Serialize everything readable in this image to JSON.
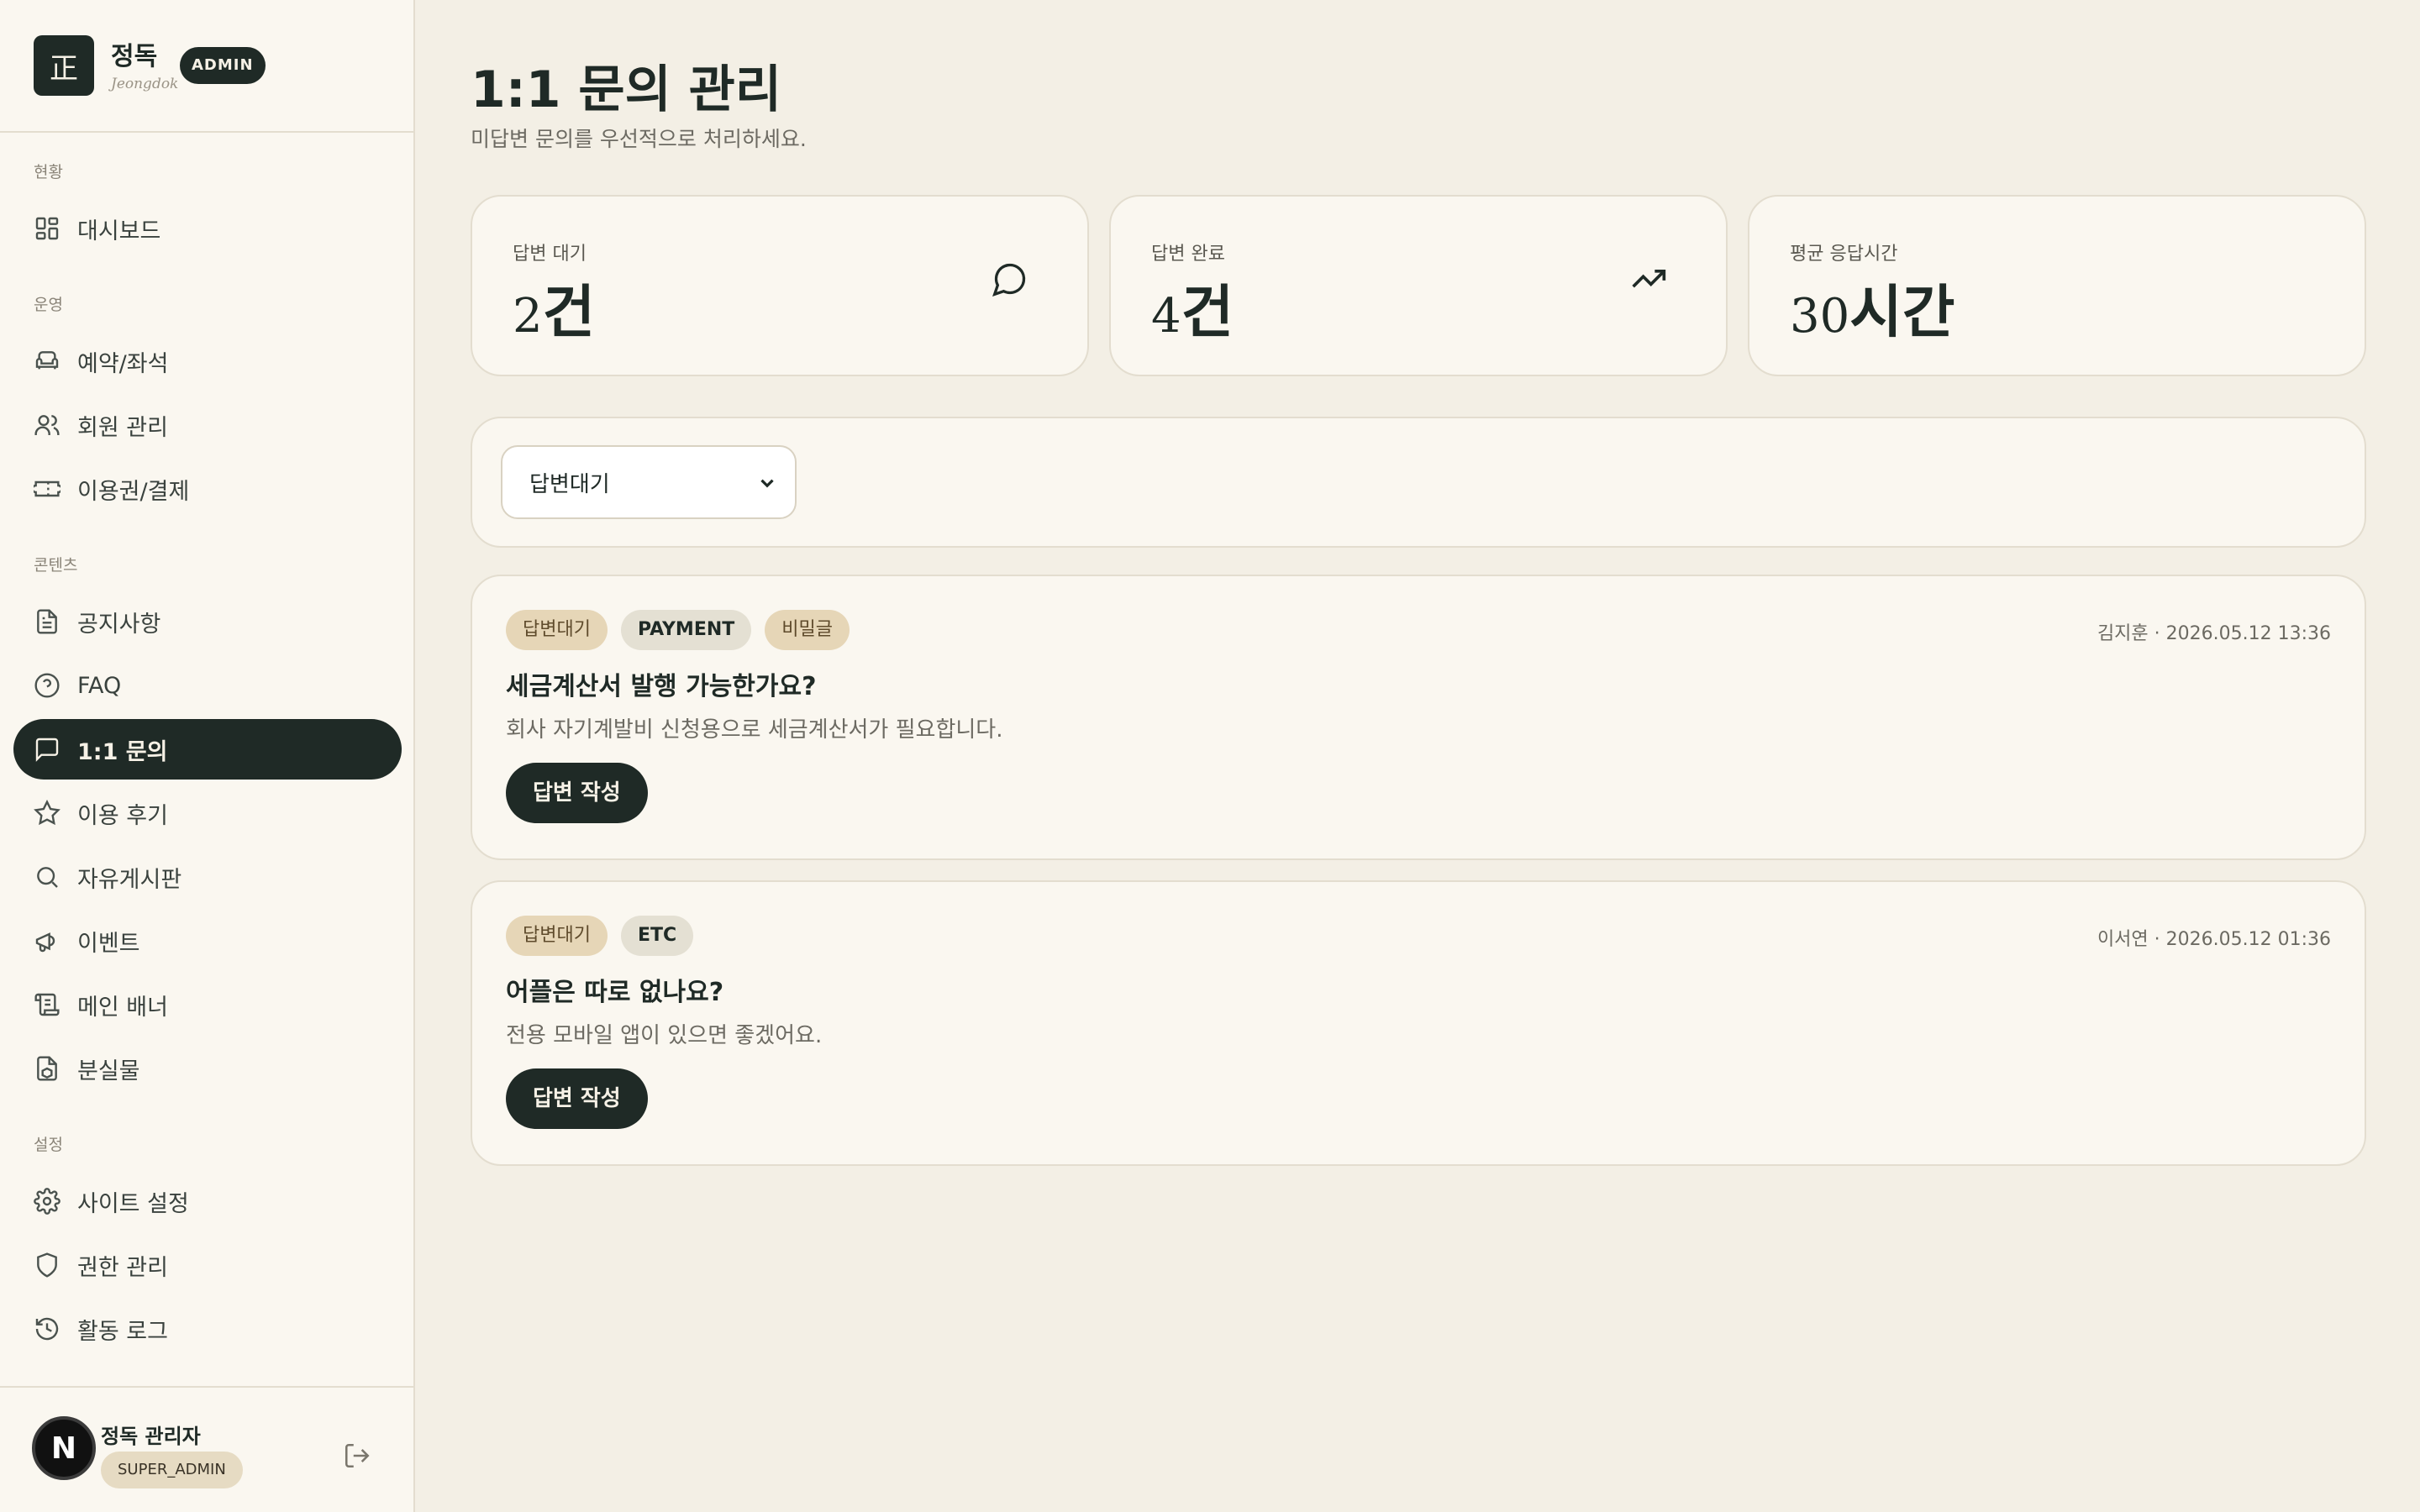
{
  "brand": {
    "logo_char": "正",
    "name": "정독",
    "subtitle": "Jeongdok",
    "badge": "ADMIN"
  },
  "sidebar": {
    "sections": [
      {
        "label": "현황",
        "items": [
          {
            "label": "대시보드",
            "icon": "dashboard-icon"
          }
        ]
      },
      {
        "label": "운영",
        "items": [
          {
            "label": "예약/좌석",
            "icon": "armchair-icon"
          },
          {
            "label": "회원 관리",
            "icon": "users-icon"
          },
          {
            "label": "이용권/결제",
            "icon": "ticket-icon"
          }
        ]
      },
      {
        "label": "콘텐츠",
        "items": [
          {
            "label": "공지사항",
            "icon": "document-icon"
          },
          {
            "label": "FAQ",
            "icon": "help-circle-icon"
          },
          {
            "label": "1:1 문의",
            "icon": "message-square-icon",
            "active": true
          },
          {
            "label": "이용 후기",
            "icon": "star-icon"
          },
          {
            "label": "자유게시판",
            "icon": "search-icon"
          },
          {
            "label": "이벤트",
            "icon": "megaphone-icon"
          },
          {
            "label": "메인 배너",
            "icon": "scroll-icon"
          },
          {
            "label": "분실물",
            "icon": "package-file-icon"
          }
        ]
      },
      {
        "label": "설정",
        "items": [
          {
            "label": "사이트 설정",
            "icon": "gear-icon"
          },
          {
            "label": "권한 관리",
            "icon": "shield-icon"
          },
          {
            "label": "활동 로그",
            "icon": "history-icon"
          }
        ]
      }
    ]
  },
  "user": {
    "avatar_letter": "N",
    "name": "정독 관리자",
    "role": "SUPER_ADMIN",
    "logout_icon": "logout-icon"
  },
  "header": {
    "title": "1:1 문의 관리",
    "subtitle": "미답변 문의를 우선적으로 처리하세요."
  },
  "stats": [
    {
      "label": "답변 대기",
      "number": "2",
      "unit": "건",
      "icon": "message-circle-icon"
    },
    {
      "label": "답변 완료",
      "number": "4",
      "unit": "건",
      "icon": "trending-up-icon"
    },
    {
      "label": "평균 응답시간",
      "number": "30",
      "unit": "시간",
      "icon": ""
    }
  ],
  "filter": {
    "selected": "답변대기"
  },
  "inquiries": [
    {
      "status": "답변대기",
      "category": "PAYMENT",
      "secret": "비밀글",
      "meta": "김지훈 · 2026.05.12 13:36",
      "title": "세금계산서 발행 가능한가요?",
      "body": "회사 자기계발비 신청용으로 세금계산서가 필요합니다.",
      "action": "답변 작성"
    },
    {
      "status": "답변대기",
      "category": "ETC",
      "secret": "",
      "meta": "이서연 · 2026.05.12 01:36",
      "title": "어플은 따로 없나요?",
      "body": "전용 모바일 앱이 있으면 좋겠어요.",
      "action": "답변 작성"
    }
  ],
  "colors": {
    "primary": "#1f2a26",
    "background": "#f3efe5",
    "surface": "#faf7f0",
    "tag_status": "#e6d6b7",
    "border": "#e3ddcf"
  }
}
